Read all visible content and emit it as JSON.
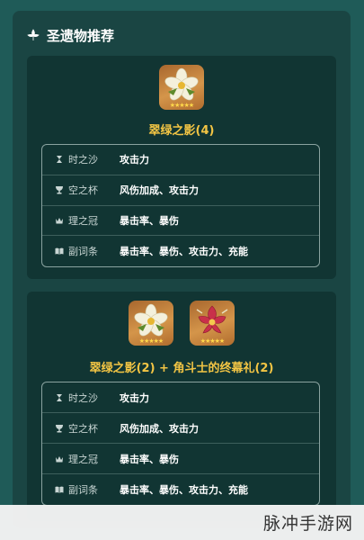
{
  "header": {
    "title": "圣遗物推荐",
    "icon": "flower-icon"
  },
  "colors": {
    "accent_gold": "#f3c544",
    "panel": "#1a4543",
    "card": "#113533"
  },
  "cards": [
    {
      "set_name": "翠绿之影(4)",
      "artifacts": [
        {
          "icon": "white-flower-artifact-icon",
          "stars": "★★★★★"
        }
      ],
      "rows": [
        {
          "slot": "时之沙",
          "icon": "hourglass-icon",
          "stat": "攻击力"
        },
        {
          "slot": "空之杯",
          "icon": "goblet-icon",
          "stat": "风伤加成、攻击力"
        },
        {
          "slot": "理之冠",
          "icon": "crown-icon",
          "stat": "暴击率、暴伤"
        },
        {
          "slot": "副词条",
          "icon": "book-icon",
          "stat": "暴击率、暴伤、攻击力、充能"
        }
      ]
    },
    {
      "set_name": "翠绿之影(2) + 角斗士的终幕礼(2)",
      "artifacts": [
        {
          "icon": "white-flower-artifact-icon",
          "stars": "★★★★★"
        },
        {
          "icon": "red-flower-artifact-icon",
          "stars": "★★★★★"
        }
      ],
      "rows": [
        {
          "slot": "时之沙",
          "icon": "hourglass-icon",
          "stat": "攻击力"
        },
        {
          "slot": "空之杯",
          "icon": "goblet-icon",
          "stat": "风伤加成、攻击力"
        },
        {
          "slot": "理之冠",
          "icon": "crown-icon",
          "stat": "暴击率、暴伤"
        },
        {
          "slot": "副词条",
          "icon": "book-icon",
          "stat": "暴击率、暴伤、攻击力、充能"
        }
      ]
    }
  ],
  "watermark": "脉冲手游网"
}
